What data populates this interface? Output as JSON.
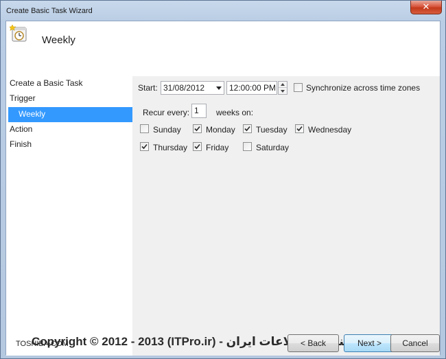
{
  "window": {
    "title": "Create Basic Task Wizard",
    "close_label": "✕"
  },
  "header": {
    "title": "Weekly",
    "icon": "task-clock-icon"
  },
  "sidebar": {
    "items": [
      {
        "label": "Create a Basic Task",
        "selected": false
      },
      {
        "label": "Trigger",
        "selected": false
      },
      {
        "label": "Weekly",
        "selected": true
      },
      {
        "label": "Action",
        "selected": false
      },
      {
        "label": "Finish",
        "selected": false
      }
    ]
  },
  "trigger": {
    "start_label": "Start:",
    "start_date": "31/08/2012",
    "start_time": "12:00:00 PM",
    "sync_label": "Synchronize across time zones",
    "sync_checked": false,
    "recur_label": "Recur every:",
    "recur_value": "1",
    "weeks_on_label": "weeks on:",
    "days": [
      {
        "label": "Sunday",
        "checked": false
      },
      {
        "label": "Monday",
        "checked": true
      },
      {
        "label": "Tuesday",
        "checked": true
      },
      {
        "label": "Wednesday",
        "checked": true
      },
      {
        "label": "Thursday",
        "checked": true
      },
      {
        "label": "Friday",
        "checked": true
      },
      {
        "label": "Saturday",
        "checked": false
      }
    ]
  },
  "footer": {
    "watermark": "Copyright © 2012 - 2013 (ITPro.ir) - انجمن تخصصی فناوری اطلاعات ایران",
    "watermark_small": "TOSHIBA.COM",
    "back_label": "< Back",
    "next_label": "Next >",
    "cancel_label": "Cancel"
  },
  "colors": {
    "selection": "#3399ff",
    "titlebar": "#c9d9ec",
    "close": "#c43a1c"
  }
}
